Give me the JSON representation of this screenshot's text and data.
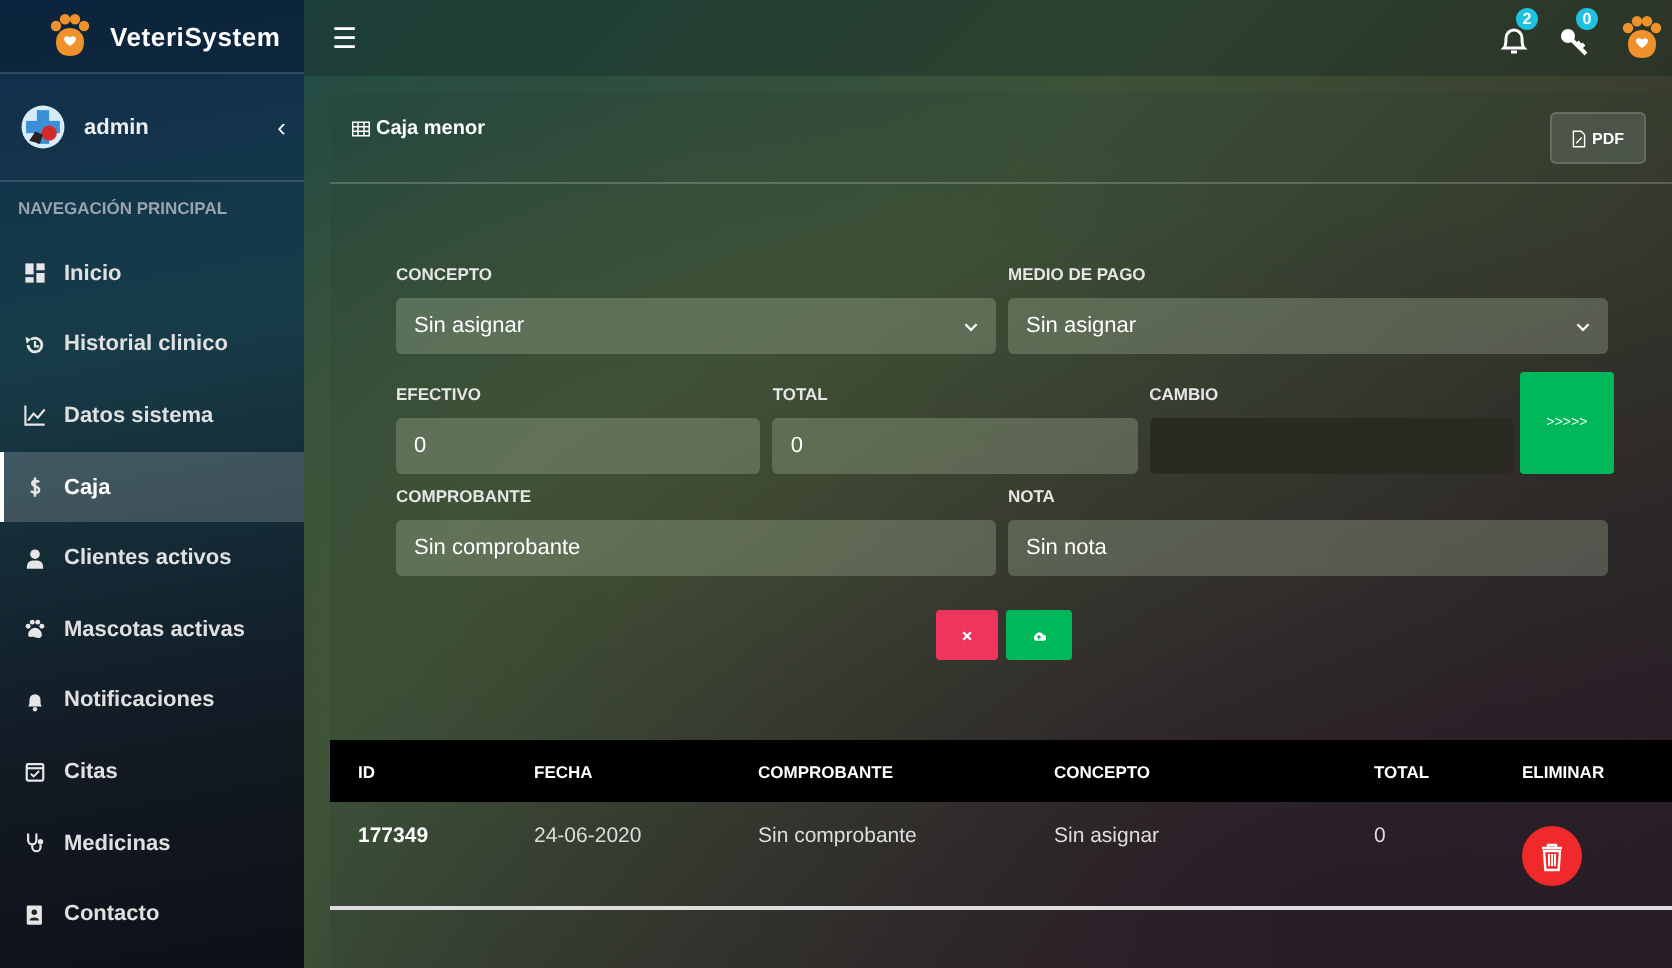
{
  "brand": {
    "name": "VeteriSystem"
  },
  "user": {
    "name": "admin",
    "collapse_glyph": "‹"
  },
  "sidebar": {
    "heading": "NAVEGACIÓN PRINCIPAL",
    "items": [
      {
        "label": "Inicio",
        "selected": false
      },
      {
        "label": "Historial clinico",
        "selected": false
      },
      {
        "label": "Datos sistema",
        "selected": false
      },
      {
        "label": "Caja",
        "selected": true
      },
      {
        "label": "Clientes activos",
        "selected": false
      },
      {
        "label": "Mascotas activas",
        "selected": false
      },
      {
        "label": "Notificaciones",
        "selected": false
      },
      {
        "label": "Citas",
        "selected": false
      },
      {
        "label": "Medicinas",
        "selected": false
      },
      {
        "label": "Contacto",
        "selected": false
      }
    ]
  },
  "topbar": {
    "menu_glyph": "☰",
    "notifications": "2",
    "keys": "0"
  },
  "card": {
    "title": "Caja menor",
    "pdf_button": "PDF"
  },
  "form": {
    "rows": [
      [
        {
          "label": "CONCEPTO",
          "kind": "select",
          "value": "Sin asignar"
        },
        {
          "label": "MEDIO DE PAGO",
          "kind": "select",
          "value": "Sin asignar"
        }
      ],
      [
        {
          "label": "EFECTIVO",
          "kind": "input",
          "value": "0",
          "disabled": false
        },
        {
          "label": "TOTAL",
          "kind": "input",
          "value": "0",
          "disabled": false
        },
        {
          "label": "CAMBIO",
          "kind": "input",
          "disabled": true
        }
      ],
      [
        {
          "label": "COMPROBANTE",
          "kind": "input",
          "value": "Sin comprobante",
          "disabled": false
        },
        {
          "label": "NOTA",
          "kind": "input",
          "value": "Sin nota",
          "disabled": false
        }
      ]
    ],
    "calc_button": ">>>>>"
  },
  "table": {
    "columns": [
      "ID",
      "FECHA",
      "COMPROBANTE",
      "CONCEPTO",
      "TOTAL",
      "ELIMINAR"
    ],
    "rows": [
      {
        "id": "177349",
        "fecha": "24-06-2020",
        "comprobante": "Sin comprobante",
        "concepto": "Sin asignar",
        "total": "0"
      }
    ]
  }
}
